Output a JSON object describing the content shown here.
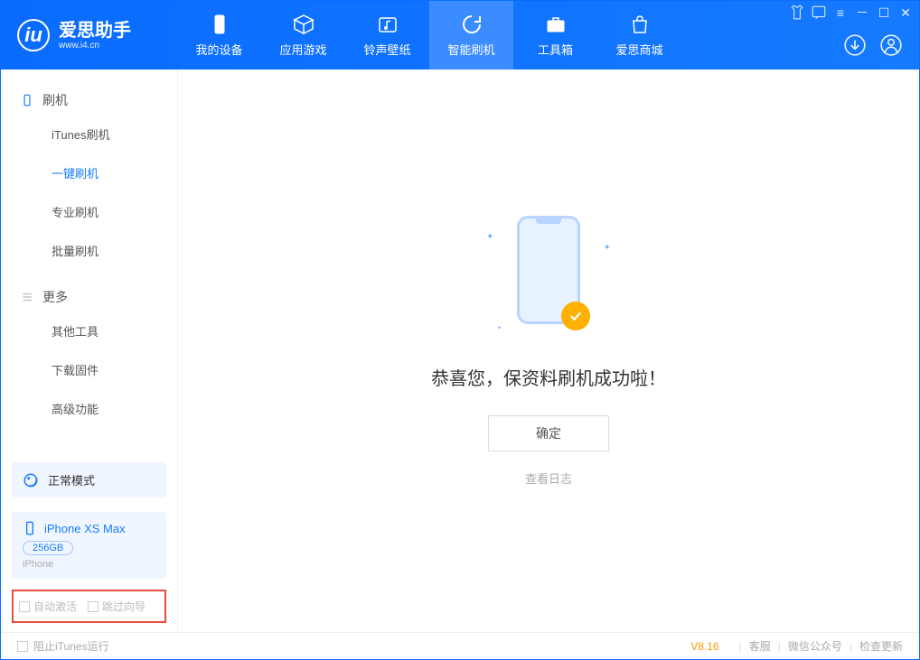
{
  "logo": {
    "title": "爱思助手",
    "subtitle": "www.i4.cn"
  },
  "nav_tabs": [
    {
      "id": "device",
      "label": "我的设备"
    },
    {
      "id": "apps",
      "label": "应用游戏"
    },
    {
      "id": "ring",
      "label": "铃声壁纸"
    },
    {
      "id": "flash",
      "label": "智能刷机"
    },
    {
      "id": "tools",
      "label": "工具箱"
    },
    {
      "id": "store",
      "label": "爱思商城"
    }
  ],
  "sidebar": {
    "group_flash": "刷机",
    "items_flash": [
      {
        "id": "itunes",
        "label": "iTunes刷机"
      },
      {
        "id": "oneclick",
        "label": "一键刷机"
      },
      {
        "id": "pro",
        "label": "专业刷机"
      },
      {
        "id": "batch",
        "label": "批量刷机"
      }
    ],
    "group_more": "更多",
    "items_more": [
      {
        "id": "other",
        "label": "其他工具"
      },
      {
        "id": "fw",
        "label": "下载固件"
      },
      {
        "id": "adv",
        "label": "高级功能"
      }
    ]
  },
  "mode_box": {
    "label": "正常模式"
  },
  "device_box": {
    "name": "iPhone XS Max",
    "capacity": "256GB",
    "type": "iPhone"
  },
  "checkboxes": {
    "auto_activate": "自动激活",
    "skip_guide": "跳过向导"
  },
  "main": {
    "success_title": "恭喜您，保资料刷机成功啦！",
    "ok_button": "确定",
    "view_log": "查看日志"
  },
  "statusbar": {
    "block_itunes": "阻止iTunes运行",
    "version": "V8.16",
    "links": [
      "客服",
      "微信公众号",
      "检查更新"
    ]
  }
}
